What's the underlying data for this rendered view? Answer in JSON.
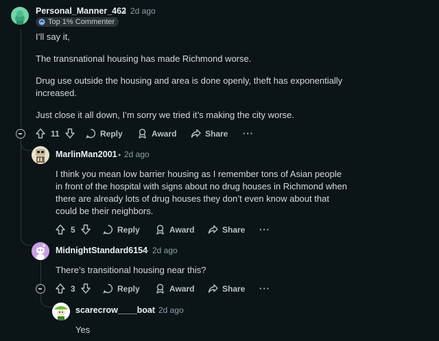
{
  "comments": [
    {
      "username": "Personal_Manner_462",
      "time": "2d ago",
      "flair": "Top 1% Commenter",
      "paragraphs": [
        "I’ll say it,",
        "The transnational housing has made Richmond worse.",
        "Drug use outside the housing and area is done openly, theft has exponentially increased.",
        "Just close it all down, I’m sorry we tried it’s making the city worse."
      ],
      "score": "11",
      "reply_label": "Reply",
      "award_label": "Award",
      "share_label": "Share",
      "more_label": "···",
      "avatar_color": "#6fd5a8"
    },
    {
      "username": "MarlinMan2001",
      "time": "2d ago",
      "text": "I think you mean low barrier housing as I remember tons of Asian people in front of the hospital with signs about no drug houses in Richmond when there are already lots of drug houses they don’t even know about that could be their neighbors.",
      "score": "5",
      "reply_label": "Reply",
      "award_label": "Award",
      "share_label": "Share",
      "more_label": "···",
      "avatar_color": "#e8e0cf"
    },
    {
      "username": "MidnightStandard6154",
      "time": "2d ago",
      "text": "There’s transitional housing near this?",
      "score": "3",
      "reply_label": "Reply",
      "award_label": "Award",
      "share_label": "Share",
      "more_label": "···",
      "avatar_color": "#c99ee6"
    },
    {
      "username": "scarecrow____boat",
      "time": "2d ago",
      "text": "Yes",
      "avatar_color": "#ffffff"
    }
  ],
  "sep": "•"
}
